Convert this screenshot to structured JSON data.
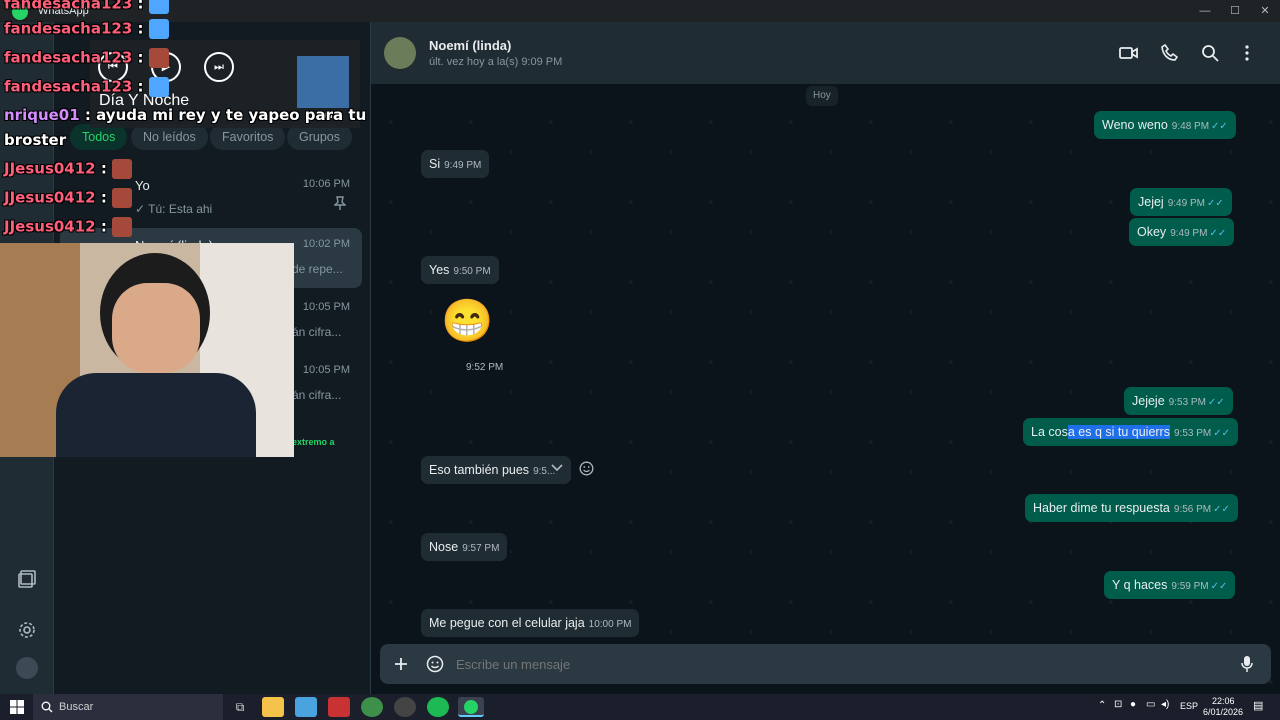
{
  "window": {
    "app_name": "WhatsApp",
    "minimize": "—",
    "maximize": "☐",
    "close": "✕"
  },
  "chat_header": {
    "contact_name": "Noemí (linda)",
    "status": "últ. vez hoy a la(s) 9:09 PM"
  },
  "filters": [
    "Todos",
    "No leídos",
    "Favoritos",
    "Grupos"
  ],
  "chat_list": [
    {
      "name": "Yo",
      "preview": "✓ Tú: Esta ahi",
      "time": "10:06 PM"
    },
    {
      "name": "Noemí (linda)",
      "preview": "de repe...",
      "time": "10:02 PM"
    },
    {
      "name": "",
      "preview": "án cifra...",
      "time": "10:05 PM"
    },
    {
      "name": "",
      "preview": "án cifra...",
      "time": "10:05 PM"
    },
    {
      "name": "",
      "preview": "extremo a",
      "time": ""
    }
  ],
  "date_divider": "Hoy",
  "messages": [
    {
      "dir": "out",
      "text": "Weno weno",
      "time": "9:48 PM"
    },
    {
      "dir": "in",
      "text": "Si",
      "time": "9:49 PM"
    },
    {
      "dir": "out",
      "text": "Jejej",
      "time": "9:49 PM"
    },
    {
      "dir": "out",
      "text": "Okey",
      "time": "9:49 PM"
    },
    {
      "dir": "in",
      "text": "Yes",
      "time": "9:50 PM"
    },
    {
      "dir": "in",
      "text": "😁",
      "time": "9:52 PM"
    },
    {
      "dir": "out",
      "text": "Jejeje",
      "time": "9:53 PM"
    },
    {
      "dir": "out",
      "text_a": "La cos",
      "text_b": "a es q si tu quierrs",
      "time": "9:53 PM"
    },
    {
      "dir": "in",
      "text": "Eso también pues",
      "time": "9:5..."
    },
    {
      "dir": "out",
      "text": "Haber dime tu respuesta",
      "time": "9:56 PM"
    },
    {
      "dir": "in",
      "text": "Nose",
      "time": "9:57 PM"
    },
    {
      "dir": "out",
      "text": "Y q haces",
      "time": "9:59 PM"
    },
    {
      "dir": "in",
      "text": "Me pegue con el celular jaja",
      "time": "10:00 PM"
    }
  ],
  "composer": {
    "placeholder": "Escribe un mensaje"
  },
  "stream_chat": [
    {
      "user": "fandesacha123",
      "sep": " :"
    },
    {
      "user": "fandesacha123",
      "sep": " :"
    },
    {
      "user": "fandesacha123",
      "sep": " :"
    },
    {
      "user": "nrique01",
      "sep": " : ayuda mi rey y te yapeo para tu"
    },
    {
      "user": "broster",
      "sep": ""
    },
    {
      "user": "JJesus0412",
      "sep": " :"
    },
    {
      "user": "JJesus0412",
      "sep": " :"
    },
    {
      "user": "JJesus0412",
      "sep": " :"
    }
  ],
  "music_player": {
    "track": "Día Y Noche",
    "service": "Spotify"
  },
  "taskbar": {
    "search_placeholder": "Buscar",
    "language": "ESP",
    "clock_time": "22:06",
    "clock_date": "6/01/2026"
  },
  "colors": {
    "accent_green": "#25d366",
    "bubble_out": "#005c4b",
    "bubble_in": "#202c33",
    "read_ticks": "#53bdeb"
  }
}
